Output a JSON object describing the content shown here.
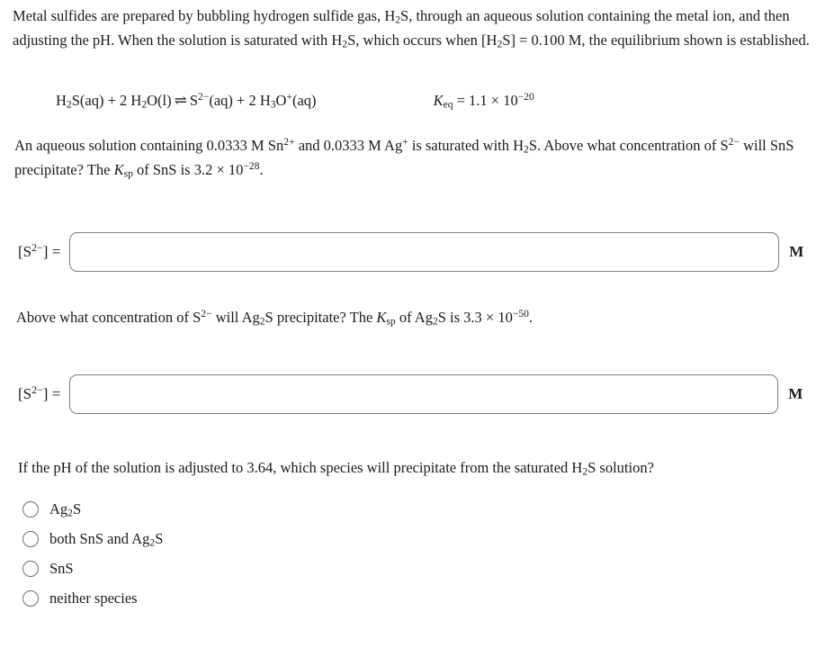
{
  "problem": {
    "intro_parts": {
      "p1": "Metal sulfides are prepared by bubbling hydrogen sulfide gas, ",
      "formula_h2s_1": "H",
      "sub_2_a": "2",
      "formula_h2s_1b": "S",
      "p2": ", through an aqueous solution containing the metal ion, and then adjusting the pH. When the solution is saturated with ",
      "formula_h2s_2": "H",
      "sub_2_b": "2",
      "formula_h2s_2b": "S",
      "p3": ", which occurs when [",
      "formula_h2s_3": "H",
      "sub_2_c": "2",
      "formula_h2s_3b": "S",
      "p4": "] = 0.100 M, the equilibrium shown is established."
    },
    "equation": {
      "reactant_1": "H",
      "reactant_1_sub": "2",
      "reactant_1_rest": "S(aq)",
      "plus_1": " + ",
      "reactant_2_coeff": "2 H",
      "reactant_2_sub": "2",
      "reactant_2_rest": "O(l)",
      "arrow": "⇌",
      "product_1": "S",
      "product_1_sup": "2−",
      "product_1_rest": "(aq)",
      "plus_2": " + ",
      "product_2_coeff": "2 H",
      "product_2_sub": "3",
      "product_2_mid": "O",
      "product_2_sup": "+",
      "product_2_rest": "(aq)",
      "k_symbol": "K",
      "k_subscript": "eq",
      "k_equals": " = 1.1 × 10",
      "k_exponent": "−20"
    },
    "question_1": {
      "t1": "An aqueous solution containing 0.0333 M Sn",
      "sup_sn": "2+",
      "t2": " and 0.0333 M Ag",
      "sup_ag": "+",
      "t3": " is saturated with ",
      "h2s_h": "H",
      "h2s_sub": "2",
      "h2s_s": "S",
      "t4": ". Above what concentration of S",
      "sup_s": "2−",
      "t5": " will SnS precipitate? The ",
      "k_symbol": "K",
      "k_sub": "sp",
      "t6": " of SnS is 3.2 × 10",
      "ksp_exponent": "−28",
      "t7": "."
    },
    "question_2": {
      "t1": "Above what concentration of S",
      "sup_s": "2−",
      "t2": " will Ag",
      "sub_ag": "2",
      "t3": "S precipitate? The ",
      "k_symbol": "K",
      "k_sub": "sp",
      "t4": " of Ag",
      "sub_ag2": "2",
      "t5": "S is 3.3 × 10",
      "ksp_exponent": "−50",
      "t6": "."
    },
    "question_3": {
      "t1": "If the pH of the solution is adjusted to 3.64, which species will precipitate from the saturated ",
      "h2s_h": "H",
      "h2s_sub": "2",
      "h2s_s": "S",
      "t2": " solution?"
    }
  },
  "answers": [
    {
      "label_open": "[S",
      "label_sup": "2−",
      "label_close": "] =",
      "value": "",
      "placeholder": "",
      "unit": "M"
    },
    {
      "label_open": "[S",
      "label_sup": "2−",
      "label_close": "] =",
      "value": "",
      "placeholder": "",
      "unit": "M"
    }
  ],
  "choices": [
    {
      "id": "choice-ag2s",
      "text_before": "Ag",
      "sub": "2",
      "text_after": "S",
      "selected": false
    },
    {
      "id": "choice-both",
      "text_before": "both SnS and Ag",
      "sub": "2",
      "text_after": "S",
      "selected": false
    },
    {
      "id": "choice-sns",
      "text_before": "SnS",
      "sub": "",
      "text_after": "",
      "selected": false
    },
    {
      "id": "choice-neither",
      "text_before": "neither species",
      "sub": "",
      "text_after": "",
      "selected": false
    }
  ],
  "colors": {
    "background": "#ffffff",
    "text": "#1a1a1a",
    "input_border": "#7d7d7d",
    "radio_border": "#6e6e6e"
  }
}
